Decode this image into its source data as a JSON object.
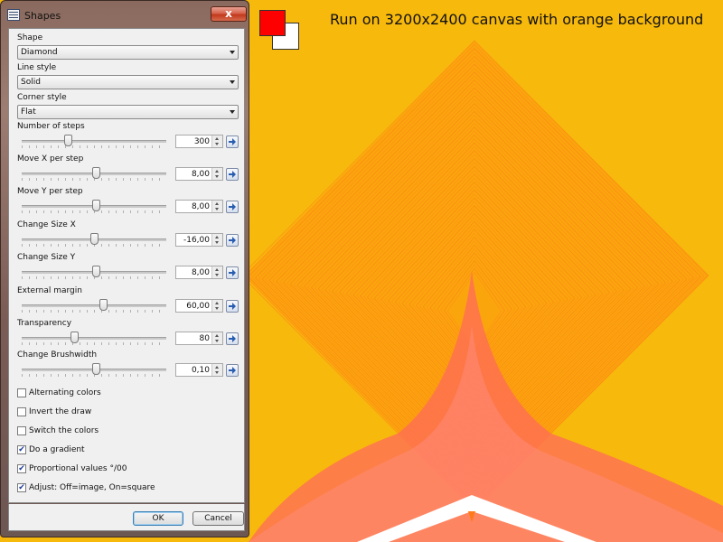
{
  "canvas": {
    "caption": "Run on 3200x2400 canvas with orange background",
    "background_color": "#f7b90c",
    "foreground_swatch": "#ff0000",
    "background_swatch": "#ffffff"
  },
  "dialog": {
    "title": "Shapes",
    "close_symbol": "x",
    "shape": {
      "label": "Shape",
      "value": "Diamond"
    },
    "line_style": {
      "label": "Line style",
      "value": "Solid"
    },
    "corner_style": {
      "label": "Corner style",
      "value": "Flat"
    },
    "sliders": [
      {
        "label": "Number of steps",
        "value": "300",
        "level": 0.32
      },
      {
        "label": "Move X per step",
        "value": "8,00",
        "level": 0.51
      },
      {
        "label": "Move Y per step",
        "value": "8,00",
        "level": 0.51
      },
      {
        "label": "Change Size X",
        "value": "-16,00",
        "level": 0.5
      },
      {
        "label": "Change Size Y",
        "value": "8,00",
        "level": 0.51
      },
      {
        "label": "External margin",
        "value": "60,00",
        "level": 0.56
      },
      {
        "label": "Transparency",
        "value": "80",
        "level": 0.36
      },
      {
        "label": "Change Brushwidth",
        "value": "0,10",
        "level": 0.51
      }
    ],
    "checkboxes": [
      {
        "label": "Alternating colors",
        "checked": false
      },
      {
        "label": "Invert the draw",
        "checked": false
      },
      {
        "label": "Switch the colors",
        "checked": false
      },
      {
        "label": "Do a gradient",
        "checked": true
      },
      {
        "label": "Proportional values °/00",
        "checked": true
      },
      {
        "label": "Adjust: Off=image, On=square",
        "checked": true
      }
    ],
    "ok_label": "OK",
    "cancel_label": "Cancel"
  }
}
